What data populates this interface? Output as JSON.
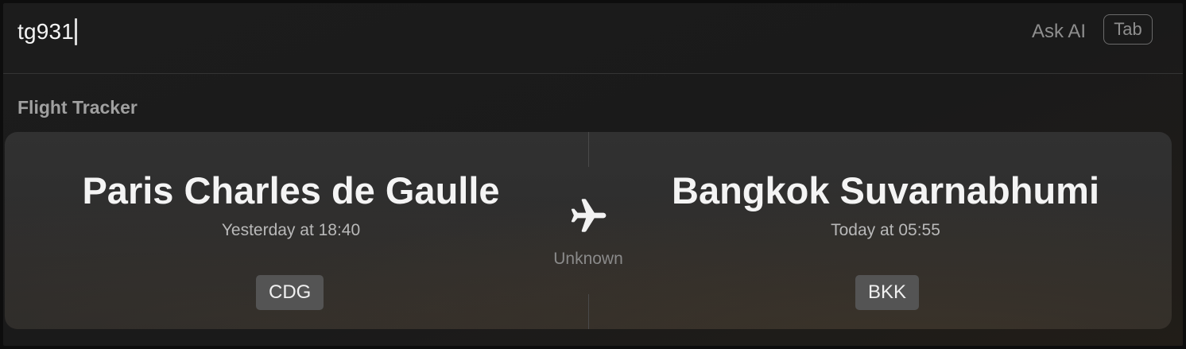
{
  "search": {
    "query": "tg931",
    "ask_ai_label": "Ask AI",
    "tab_key_label": "Tab"
  },
  "section": {
    "title": "Flight Tracker"
  },
  "flight": {
    "departure": {
      "airport": "Paris Charles de Gaulle",
      "time": "Yesterday at 18:40",
      "code": "CDG"
    },
    "arrival": {
      "airport": "Bangkok Suvarnabhumi",
      "time": "Today at 05:55",
      "code": "BKK"
    },
    "status": "Unknown",
    "icon": "airplane-icon"
  }
}
